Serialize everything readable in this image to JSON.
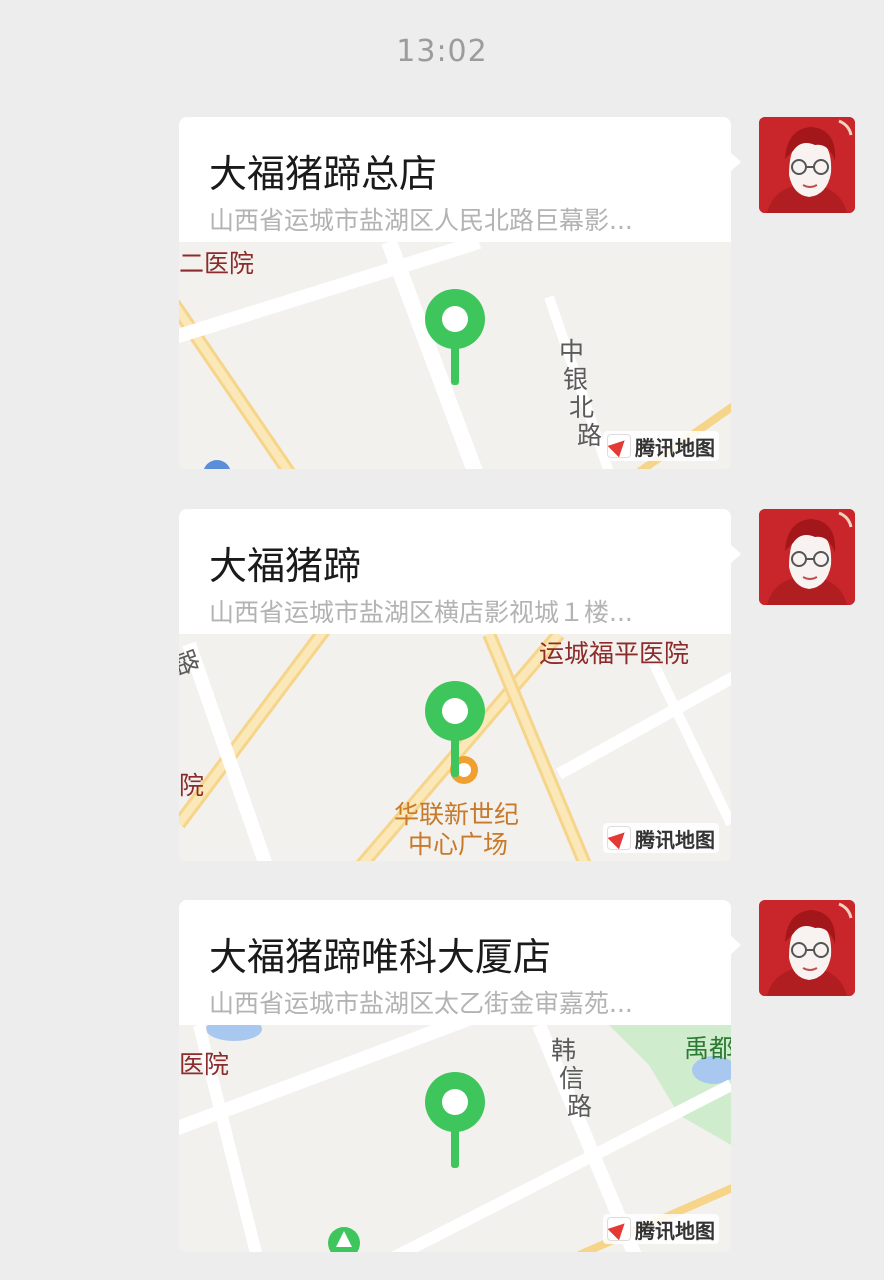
{
  "header": {
    "time": "13:02"
  },
  "messages": [
    {
      "title": "大福猪蹄总店",
      "address": "山西省运城市盐湖区人民北路巨幕影...",
      "map_labels": [
        "二医院",
        "中",
        "银",
        "北",
        "路"
      ],
      "attribution": "腾讯地图"
    },
    {
      "title": "大福猪蹄",
      "address": "山西省运城市盐湖区横店影视城１楼...",
      "map_labels": [
        "运城福平医院",
        "路",
        "院",
        "华联新世纪",
        "中心广场"
      ],
      "attribution": "腾讯地图"
    },
    {
      "title": "大福猪蹄唯科大厦店",
      "address": "山西省运城市盐湖区太乙街金审嘉苑...",
      "map_labels": [
        "医院",
        "禹都",
        "韩",
        "信",
        "路"
      ],
      "attribution": "腾讯地图"
    }
  ],
  "colors": {
    "background": "#ededed",
    "bubble": "#ffffff",
    "pin": "#3ec65c",
    "avatar": "#c8262b"
  },
  "icons": [
    "location-pin-icon",
    "compass-icon",
    "avatar"
  ]
}
